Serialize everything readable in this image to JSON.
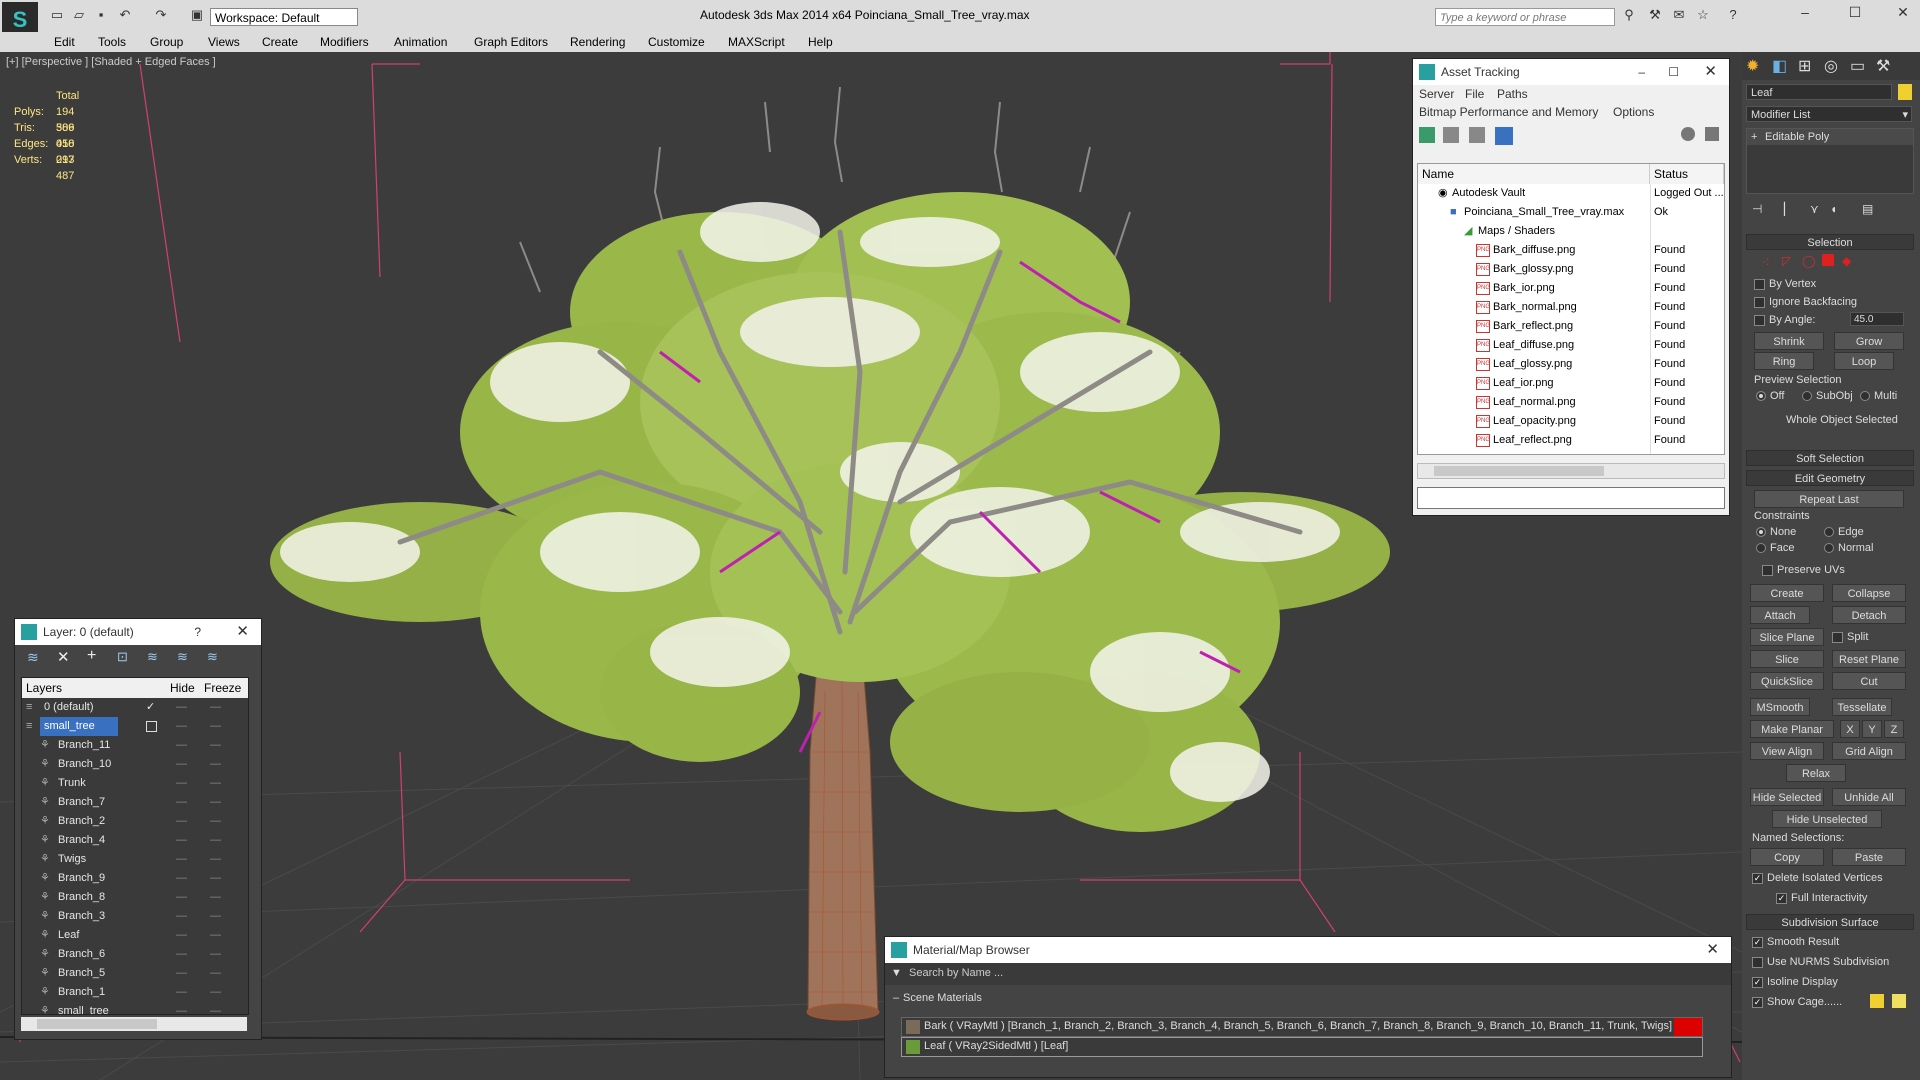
{
  "app": {
    "title": "Autodesk 3ds Max  2014 x64     Poinciana_Small_Tree_vray.max",
    "workspace": "Workspace: Default",
    "search_placeholder": "Type a keyword or phrase"
  },
  "menu": [
    "Edit",
    "Tools",
    "Group",
    "Views",
    "Create",
    "Modifiers",
    "Animation",
    "Graph Editors",
    "Rendering",
    "Customize",
    "MAXScript",
    "Help"
  ],
  "viewport": {
    "label": "[+] [Perspective ] [Shaded + Edged Faces ]",
    "stats": {
      "header": "Total",
      "rows": [
        {
          "k": "Polys:",
          "v": "194 506"
        },
        {
          "k": "Tris:",
          "v": "389 010"
        },
        {
          "k": "Edges:",
          "v": "458 017"
        },
        {
          "k": "Verts:",
          "v": "293 487"
        }
      ]
    }
  },
  "asset_tracking": {
    "title": "Asset Tracking",
    "menu1": [
      "Server",
      "File",
      "Paths"
    ],
    "menu2": [
      "Bitmap Performance and Memory",
      "Options"
    ],
    "col_name": "Name",
    "col_status": "Status",
    "rows": [
      {
        "name": "Autodesk Vault",
        "status": "Logged Out ..."
      },
      {
        "name": "Poinciana_Small_Tree_vray.max",
        "status": "Ok"
      },
      {
        "name": "Maps / Shaders",
        "status": ""
      },
      {
        "name": "Bark_diffuse.png",
        "status": "Found"
      },
      {
        "name": "Bark_glossy.png",
        "status": "Found"
      },
      {
        "name": "Bark_ior.png",
        "status": "Found"
      },
      {
        "name": "Bark_normal.png",
        "status": "Found"
      },
      {
        "name": "Bark_reflect.png",
        "status": "Found"
      },
      {
        "name": "Leaf_diffuse.png",
        "status": "Found"
      },
      {
        "name": "Leaf_glossy.png",
        "status": "Found"
      },
      {
        "name": "Leaf_ior.png",
        "status": "Found"
      },
      {
        "name": "Leaf_normal.png",
        "status": "Found"
      },
      {
        "name": "Leaf_opacity.png",
        "status": "Found"
      },
      {
        "name": "Leaf_reflect.png",
        "status": "Found"
      }
    ]
  },
  "layer_panel": {
    "title": "Layer: 0 (default)",
    "help": "?",
    "col_layers": "Layers",
    "col_hide": "Hide",
    "col_freeze": "Freeze",
    "items": [
      {
        "name": "0 (default)"
      },
      {
        "name": "small_tree"
      },
      {
        "name": "Branch_11"
      },
      {
        "name": "Branch_10"
      },
      {
        "name": "Trunk"
      },
      {
        "name": "Branch_7"
      },
      {
        "name": "Branch_2"
      },
      {
        "name": "Branch_4"
      },
      {
        "name": "Twigs"
      },
      {
        "name": "Branch_9"
      },
      {
        "name": "Branch_8"
      },
      {
        "name": "Branch_3"
      },
      {
        "name": "Leaf"
      },
      {
        "name": "Branch_6"
      },
      {
        "name": "Branch_5"
      },
      {
        "name": "Branch_1"
      },
      {
        "name": "small_tree"
      }
    ]
  },
  "material_browser": {
    "title": "Material/Map Browser",
    "search_placeholder": "Search by Name ...",
    "group": "Scene Materials",
    "items": [
      {
        "label": "Bark  ( VRayMtl )  [Branch_1, Branch_2, Branch_3, Branch_4, Branch_5, Branch_6, Branch_7, Branch_8, Branch_9, Branch_10, Branch_11, Trunk, Twigs]"
      },
      {
        "label": "Leaf  ( VRay2SidedMtl )  [Leaf]"
      }
    ]
  },
  "command_panel": {
    "object_name": "Leaf",
    "modifier_list": "Modifier List",
    "stack_item": "Editable Poly",
    "selection": {
      "header": "Selection",
      "by_vertex": "By Vertex",
      "ignore_backfacing": "Ignore Backfacing",
      "by_angle": "By Angle:",
      "angle_value": "45.0",
      "shrink": "Shrink",
      "grow": "Grow",
      "ring": "Ring",
      "loop": "Loop",
      "preview": "Preview Selection",
      "off": "Off",
      "subobj": "SubObj",
      "multi": "Multi",
      "status": "Whole Object Selected"
    },
    "soft_selection": "Soft Selection",
    "edit_geometry": {
      "header": "Edit Geometry",
      "repeat_last": "Repeat Last",
      "constraints": "Constraints",
      "none": "None",
      "edge": "Edge",
      "face": "Face",
      "normal": "Normal",
      "preserve_uvs": "Preserve UVs",
      "create": "Create",
      "collapse": "Collapse",
      "attach": "Attach",
      "detach": "Detach",
      "slice_plane": "Slice Plane",
      "split": "Split",
      "slice": "Slice",
      "reset_plane": "Reset Plane",
      "quickslice": "QuickSlice",
      "cut": "Cut",
      "msmooth": "MSmooth",
      "tessellate": "Tessellate",
      "make_planar": "Make Planar",
      "x": "X",
      "y": "Y",
      "z": "Z",
      "view_align": "View Align",
      "grid_align": "Grid Align",
      "relax": "Relax",
      "hide_selected": "Hide Selected",
      "unhide_all": "Unhide All",
      "hide_unselected": "Hide Unselected",
      "named_selections": "Named Selections:",
      "copy": "Copy",
      "paste": "Paste",
      "delete_isolated": "Delete Isolated Vertices",
      "full_interactivity": "Full Interactivity"
    },
    "subdivision": {
      "header": "Subdivision Surface",
      "smooth_result": "Smooth Result",
      "use_nurms": "Use NURMS Subdivision",
      "isoline": "Isoline Display",
      "show_cage": "Show Cage......"
    }
  },
  "colors": {
    "viewport_bg": "#3c3c3c",
    "leaf_green": "#9ab84a",
    "leaf_white": "#f4f4ec",
    "branch_grey": "#8e8a86",
    "branch_magenta": "#c020b0",
    "trunk_brown": "#a0745a",
    "stats_yellow": "#ffe680",
    "selection_blue": "#3a70c0"
  }
}
